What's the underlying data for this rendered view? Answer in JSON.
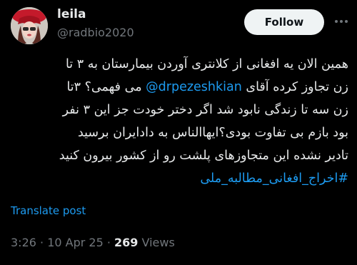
{
  "user": {
    "name": "leila",
    "handle": "@radbio2020"
  },
  "follow_label": "Follow",
  "tweet": {
    "line1": "همین الان یه افغانی از کلانتری آوردن بیمارستان به ۳ تا",
    "line2_pre": "زن تجاوز کرده آقای",
    "mention": "@drpezeshkian",
    "line2_post": "می فهمی؟ ۳تا",
    "line3": "زن سه تا زندگی نابود شد اگر دختر خودت جز این ۳ نفر",
    "line4": "بود بازم بی تفاوت بودی؟ایهاالناس به دادایران برسید",
    "line5": "تادیر نشده این متجاوزهای پلشت رو از کشور بیرون کنید",
    "hashtag": "#اخراج_افغانی_مطالبه_ملی"
  },
  "translate_label": "Translate post",
  "meta": {
    "time": "3:26 · 10 Apr 25 · ",
    "views_count": "269",
    "views_label": " Views"
  }
}
